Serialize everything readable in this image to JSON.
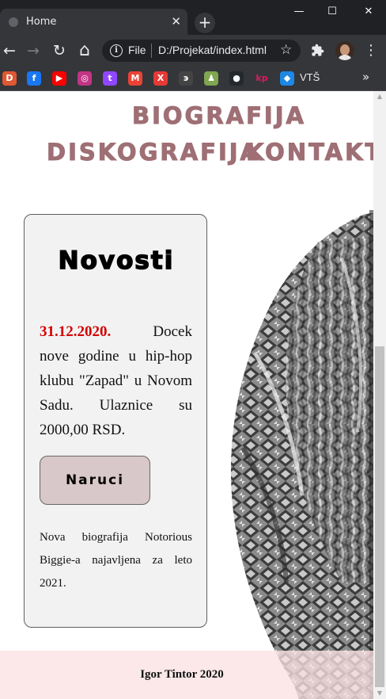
{
  "browser": {
    "tab_title": "Home",
    "tab_close": "✕",
    "new_tab": "+",
    "window_controls": {
      "minimize": "—",
      "maximize": "☐",
      "close": "✕"
    },
    "nav": {
      "back": "←",
      "forward": "→",
      "reload": "↻",
      "home": "⌂"
    },
    "address": {
      "scheme_label": "File",
      "url": "D:/Projekat/index.html",
      "info_icon": "i",
      "star": "☆"
    },
    "extensions_icon": "puzzle-icon",
    "menu": "⋮",
    "bookmarks": [
      {
        "name": "duckduckgo-icon",
        "glyph": "D",
        "color": "#de5833"
      },
      {
        "name": "facebook-icon",
        "glyph": "f",
        "color": "#1877f2"
      },
      {
        "name": "youtube-icon",
        "glyph": "▶",
        "color": "#ff0000"
      },
      {
        "name": "instagram-icon",
        "glyph": "◎",
        "color": "#c13584"
      },
      {
        "name": "twitch-icon",
        "glyph": "t",
        "color": "#9146ff"
      },
      {
        "name": "gmail-icon",
        "glyph": "M",
        "color": "#ea4335"
      },
      {
        "name": "x-icon",
        "glyph": "X",
        "color": "#e53935"
      },
      {
        "name": "bookmark-8-icon",
        "glyph": "э",
        "color": "#444444"
      },
      {
        "name": "chess-icon",
        "glyph": "♟",
        "color": "#7fa650"
      },
      {
        "name": "github-icon",
        "glyph": "●",
        "color": "#24292e"
      },
      {
        "name": "kinopoisk-icon",
        "glyph": "kp",
        "color": "#f5f5f5"
      },
      {
        "name": "vts-icon",
        "glyph": "◆",
        "color": "#1e88e5"
      }
    ],
    "bookmark_label": "VTŠ",
    "bookmarks_more": "»"
  },
  "nav": {
    "biografija": "Biografija",
    "diskografija": "Diskografija",
    "kontakt": "Kontakt"
  },
  "news": {
    "title": "Novosti",
    "date": "31.12.2020.",
    "text": "Docek nove godine u hip-hop klubu \"Zapad\" u Novom Sadu. Ulaznice su 2000,00 RSD.",
    "button": "Naruci",
    "note": "Nova biografija Notorious Biggie-a najavljena za leto 2021."
  },
  "footer": {
    "text": "Igor Tintor 2020"
  }
}
